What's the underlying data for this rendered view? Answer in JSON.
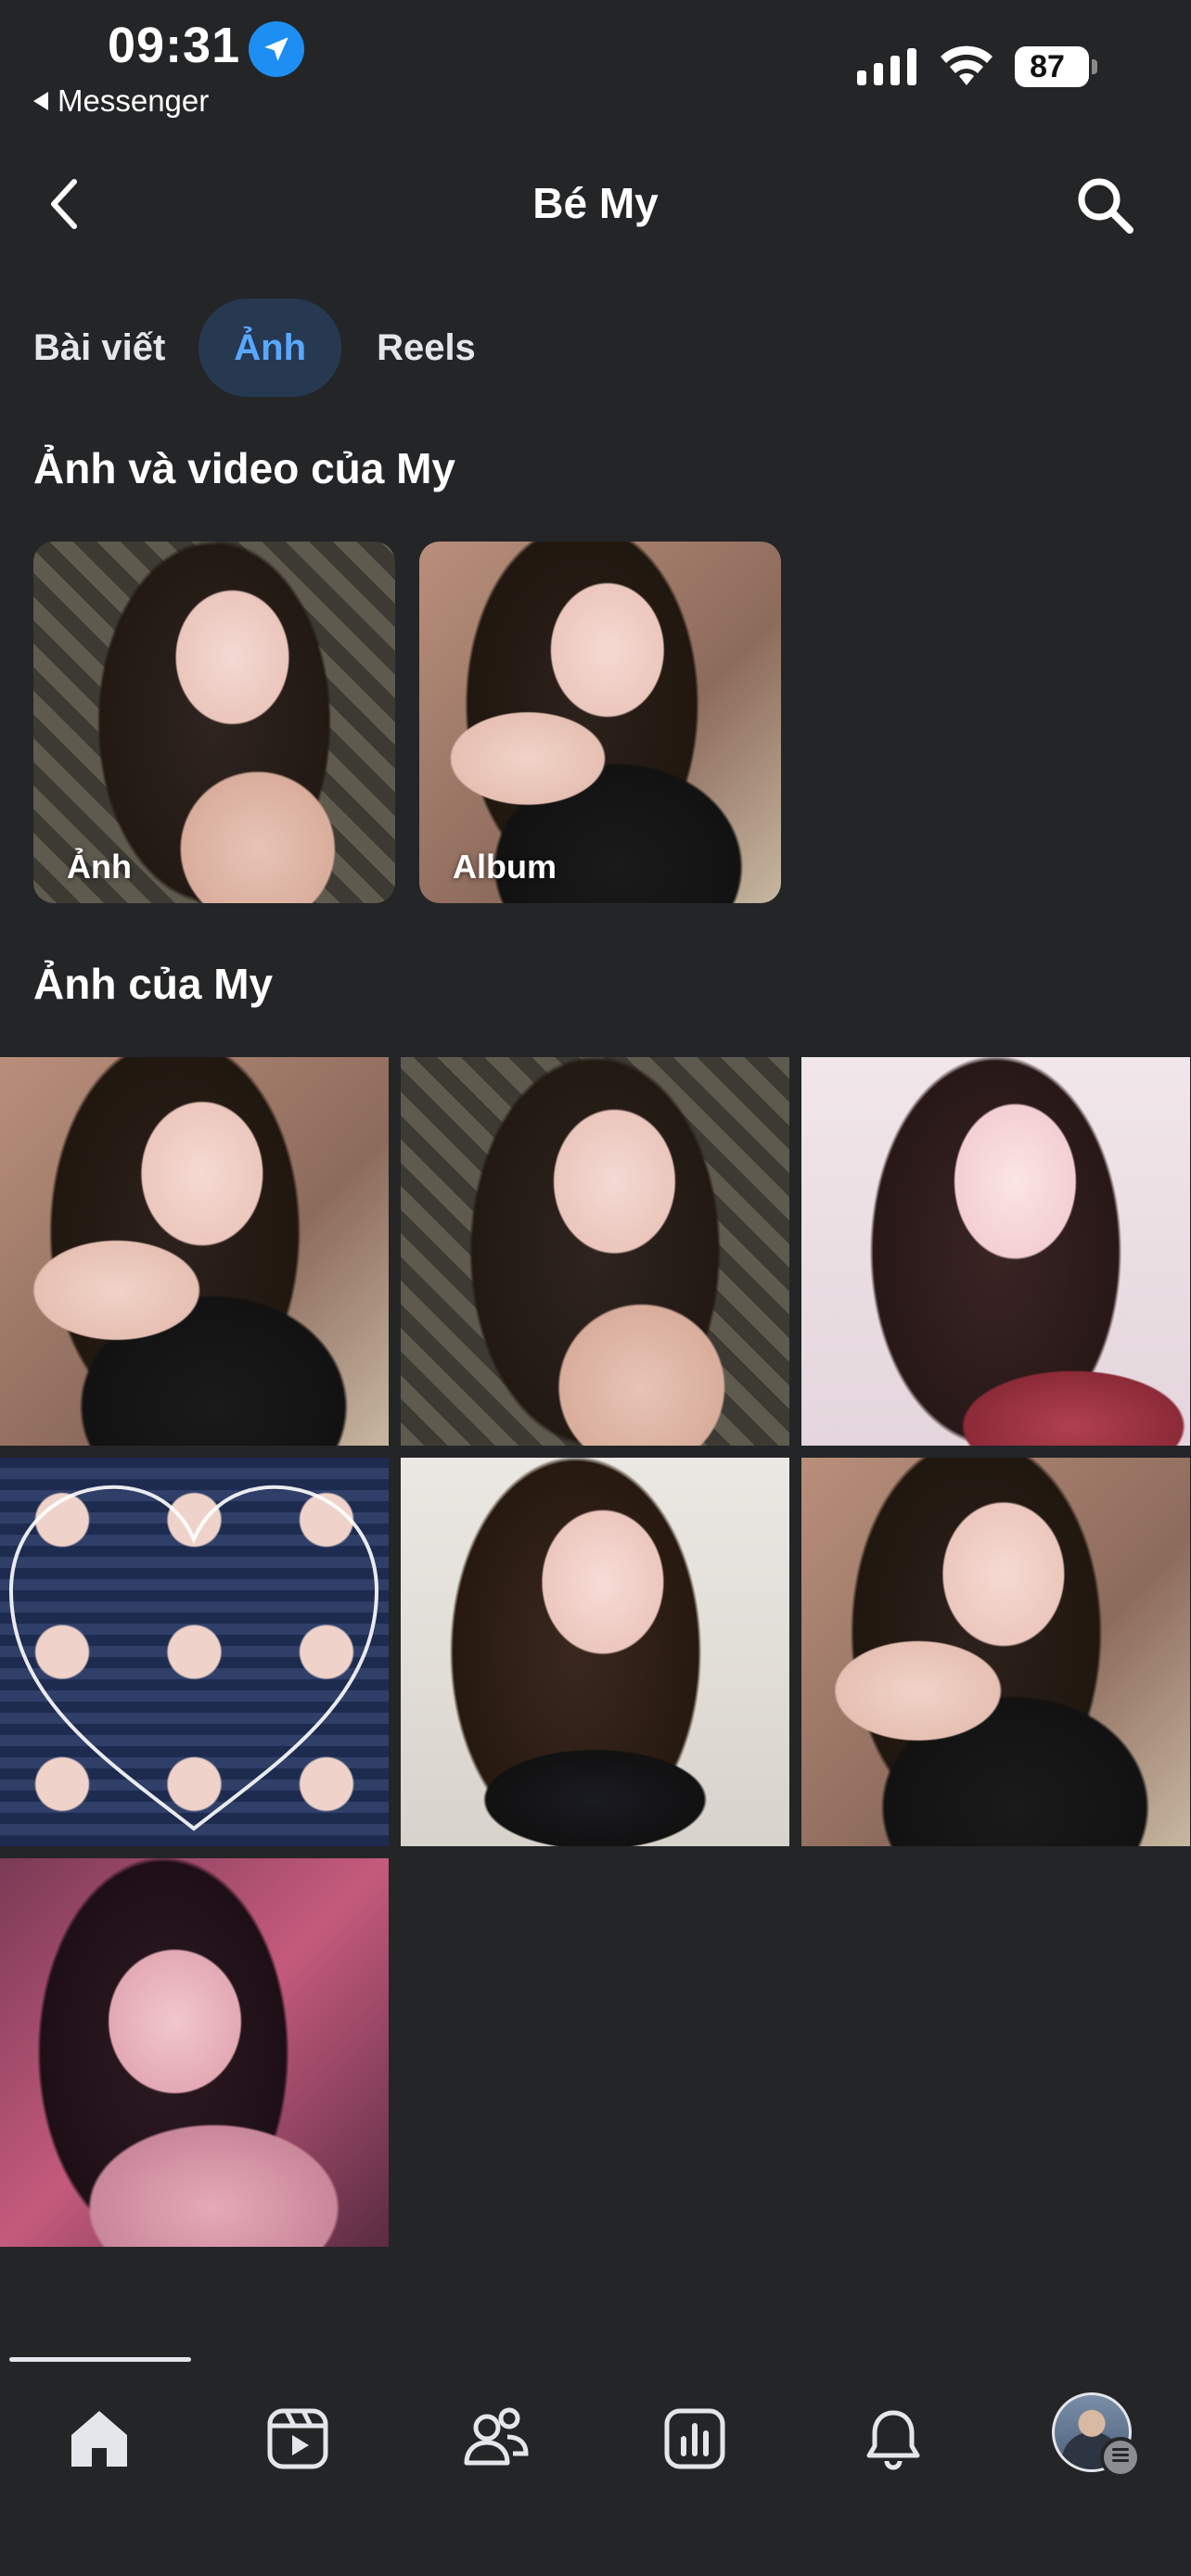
{
  "status_bar": {
    "time": "09:31",
    "back_app": "Messenger",
    "battery": "87",
    "location_icon": "location-arrow-icon",
    "signal_icon": "cellular-signal-icon",
    "wifi_icon": "wifi-icon"
  },
  "header": {
    "title": "Bé My",
    "back_icon": "chevron-left-icon",
    "search_icon": "search-icon"
  },
  "tabs": [
    {
      "label": "Bài viết",
      "active": false
    },
    {
      "label": "Ảnh",
      "active": true
    },
    {
      "label": "Reels",
      "active": false
    }
  ],
  "sections": {
    "media_title": "Ảnh và video của My",
    "albums": [
      {
        "label": "Ảnh"
      },
      {
        "label": "Album"
      }
    ],
    "photos_title": "Ảnh của My",
    "photo_count": 7
  },
  "bottom_nav": [
    {
      "name": "home-icon",
      "active": true
    },
    {
      "name": "video-icon",
      "active": false
    },
    {
      "name": "friends-icon",
      "active": false
    },
    {
      "name": "dashboard-icon",
      "active": false
    },
    {
      "name": "bell-icon",
      "active": false
    },
    {
      "name": "profile-avatar",
      "active": false
    }
  ],
  "colors": {
    "background": "#232527",
    "accent": "#5aa7ff",
    "active_tab_bg": "#263951",
    "text": "#e4e6eb"
  }
}
